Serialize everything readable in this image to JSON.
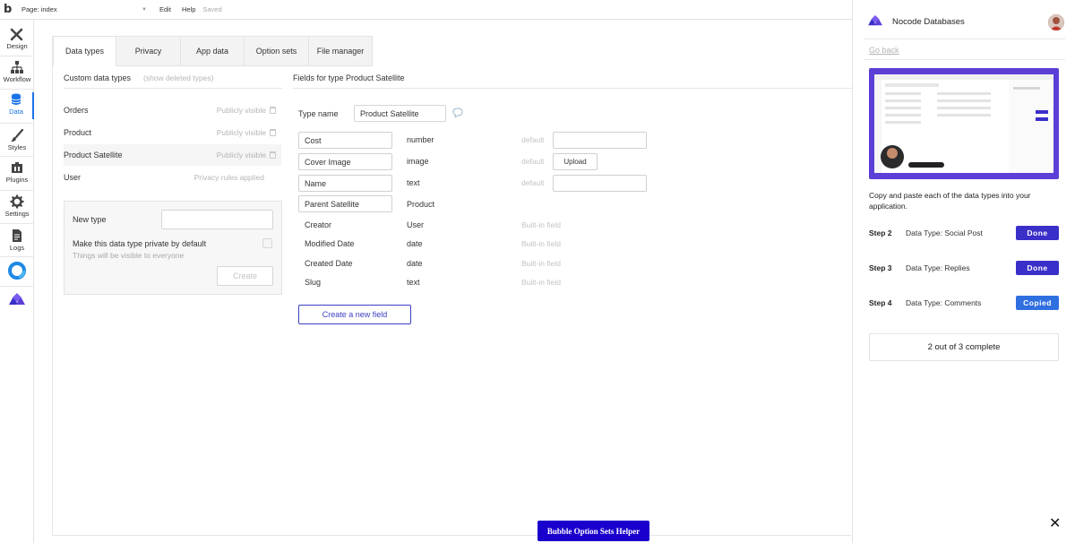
{
  "topbar": {
    "logo": "b",
    "page_select": "Page: index",
    "menu": [
      "Edit",
      "Help"
    ],
    "status": "Saved"
  },
  "sidebar": {
    "items": [
      {
        "label": "Design",
        "icon": "design-icon"
      },
      {
        "label": "Workflow",
        "icon": "workflow-icon"
      },
      {
        "label": "Data",
        "icon": "database-icon",
        "active": true
      },
      {
        "label": "Styles",
        "icon": "brush-icon"
      },
      {
        "label": "Plugins",
        "icon": "plugin-icon"
      },
      {
        "label": "Settings",
        "icon": "gear-icon"
      },
      {
        "label": "Logs",
        "icon": "logs-icon"
      }
    ],
    "extra_icons": [
      "ring-logo-icon",
      "nocode-databases-logo-icon"
    ]
  },
  "tabs": [
    "Data types",
    "Privacy",
    "App data",
    "Option sets",
    "File manager"
  ],
  "data_types": {
    "heading": "Custom data types",
    "show_deleted": "(show deleted types)",
    "rows": [
      {
        "name": "Orders",
        "visibility": "Publicly visible",
        "trash": true
      },
      {
        "name": "Product",
        "visibility": "Publicly visible",
        "trash": true
      },
      {
        "name": "Product Satellite",
        "visibility": "Publicly visible",
        "trash": true,
        "selected": true
      },
      {
        "name": "User",
        "visibility": "Privacy rules applied",
        "trash": false
      }
    ],
    "new_type": {
      "label": "New type",
      "private_label": "Make this data type private by default",
      "private_hint": "Things will be visible to everyone",
      "create_button": "Create"
    }
  },
  "fields": {
    "heading": "Fields for type Product Satellite",
    "type_name_label": "Type name",
    "type_name_value": "Product Satellite",
    "editable": [
      {
        "name": "Cost",
        "type": "number",
        "default": "default",
        "control": "input"
      },
      {
        "name": "Cover Image",
        "type": "image",
        "default": "default",
        "control": "upload",
        "control_label": "Upload"
      },
      {
        "name": "Name",
        "type": "text",
        "default": "default",
        "control": "input"
      },
      {
        "name": "Parent Satellite",
        "type": "Product"
      }
    ],
    "builtin": [
      {
        "name": "Creator",
        "type": "User",
        "note": "Built-in field"
      },
      {
        "name": "Modified Date",
        "type": "date",
        "note": "Built-in field"
      },
      {
        "name": "Created Date",
        "type": "date",
        "note": "Built-in field"
      },
      {
        "name": "Slug",
        "type": "text",
        "note": "Built-in field"
      }
    ],
    "create_button": "Create a new field"
  },
  "right_panel": {
    "brand": "Nocode Databases",
    "go_back": "Go back",
    "description": "Copy and paste each of the data types into your application.",
    "steps": [
      {
        "num": "Step 2",
        "label": "Data Type: Social Post",
        "button": "Done",
        "color": "#3b2fc9"
      },
      {
        "num": "Step 3",
        "label": "Data Type: Replies",
        "button": "Done",
        "color": "#3b2fc9"
      },
      {
        "num": "Step 4",
        "label": "Data Type: Comments",
        "button": "Copied",
        "color": "#2f6fe0"
      }
    ],
    "progress": "2 out of 3 complete",
    "close_icon": "close-icon",
    "accent": "#5b3fd6"
  },
  "helper_button": "Bubble Option Sets Helper"
}
